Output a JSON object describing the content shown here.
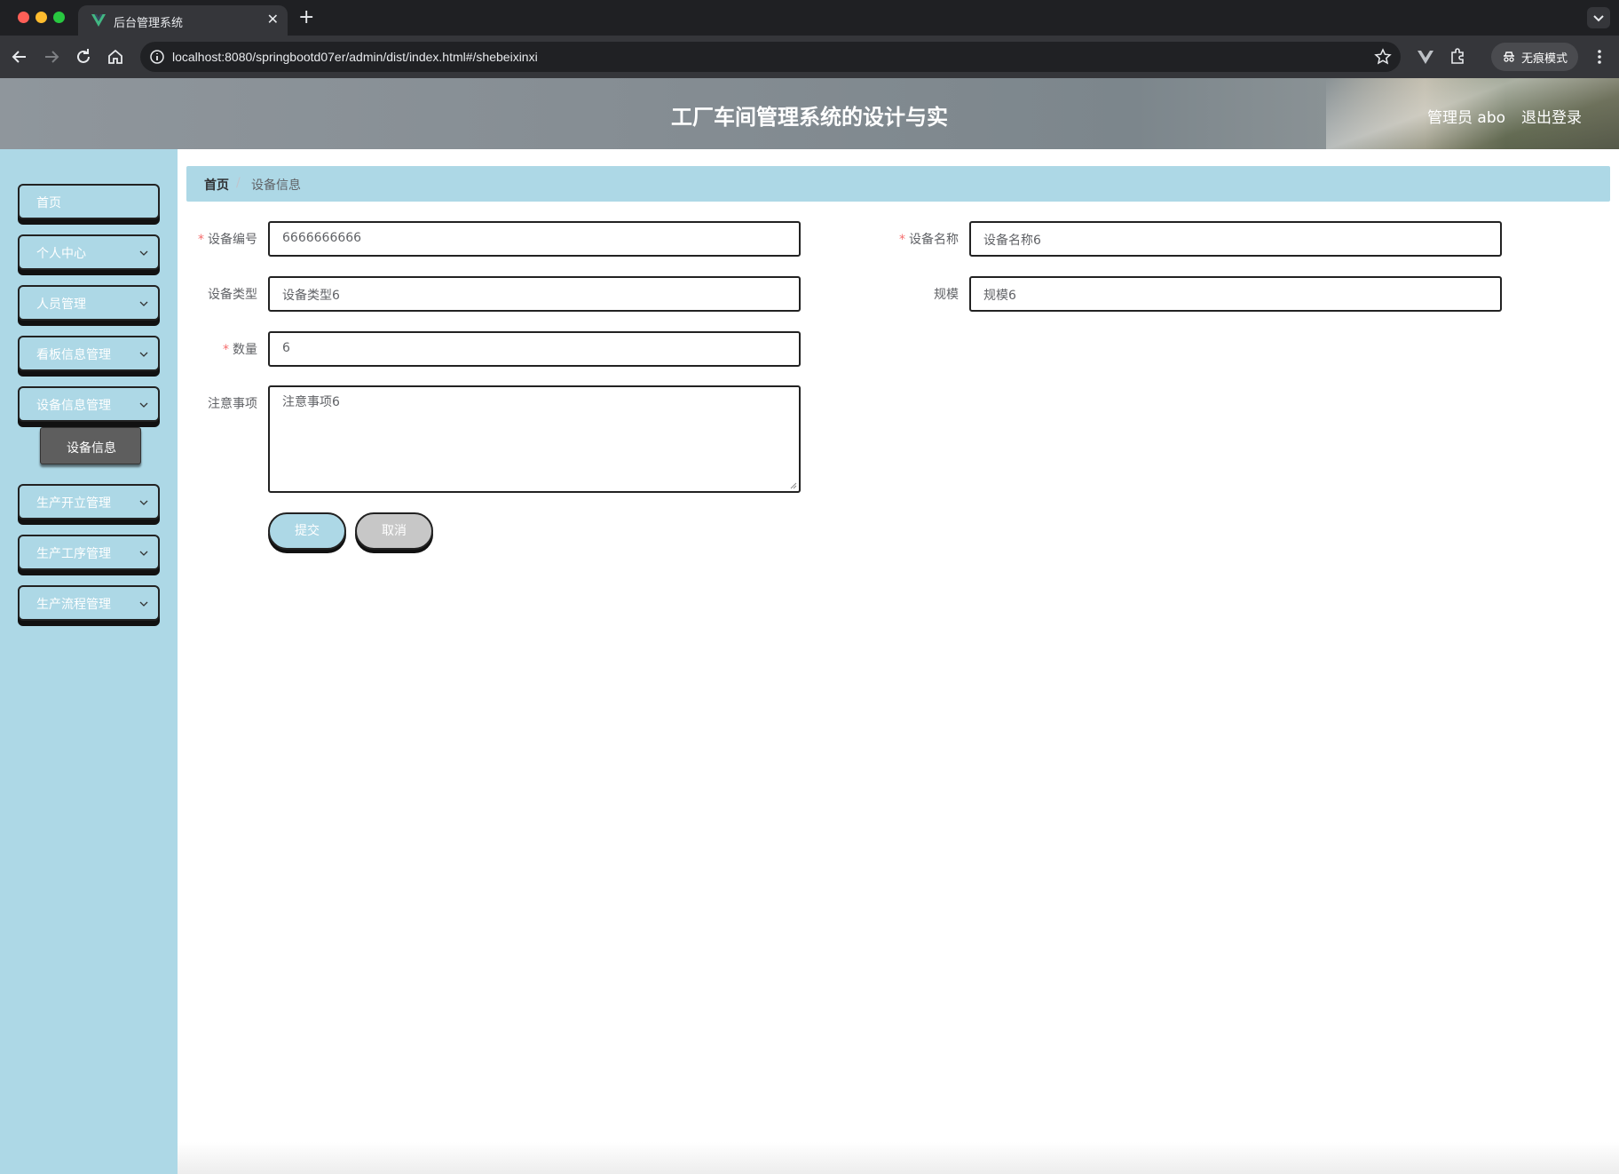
{
  "browser": {
    "tab_title": "后台管理系统",
    "url": "localhost:8080/springbootd07er/admin/dist/index.html#/shebeixinxi",
    "incognito_label": "无痕模式"
  },
  "header": {
    "title": "工厂车间管理系统的设计与实",
    "user": "管理员 abo",
    "logout": "退出登录"
  },
  "sidebar": {
    "items": [
      {
        "label": "首页"
      },
      {
        "label": "个人中心"
      },
      {
        "label": "人员管理"
      },
      {
        "label": "看板信息管理"
      },
      {
        "label": "设备信息管理"
      },
      {
        "label": "生产开立管理"
      },
      {
        "label": "生产工序管理"
      },
      {
        "label": "生产流程管理"
      }
    ],
    "sub_item": {
      "label": "设备信息"
    }
  },
  "breadcrumb": {
    "home": "首页",
    "separator": "/",
    "current": "设备信息"
  },
  "form": {
    "required_mark": "*",
    "device_code": {
      "label": "设备编号",
      "value": "6666666666"
    },
    "device_name": {
      "label": "设备名称",
      "value": "设备名称6"
    },
    "device_type": {
      "label": "设备类型",
      "value": "设备类型6"
    },
    "scale": {
      "label": "规模",
      "value": "规模6"
    },
    "quantity": {
      "label": "数量",
      "value": "6"
    },
    "notes": {
      "label": "注意事项",
      "value": "注意事项6"
    },
    "submit": "提交",
    "cancel": "取消"
  },
  "colors": {
    "accent": "#add8e6",
    "required": "#f56c6c"
  }
}
